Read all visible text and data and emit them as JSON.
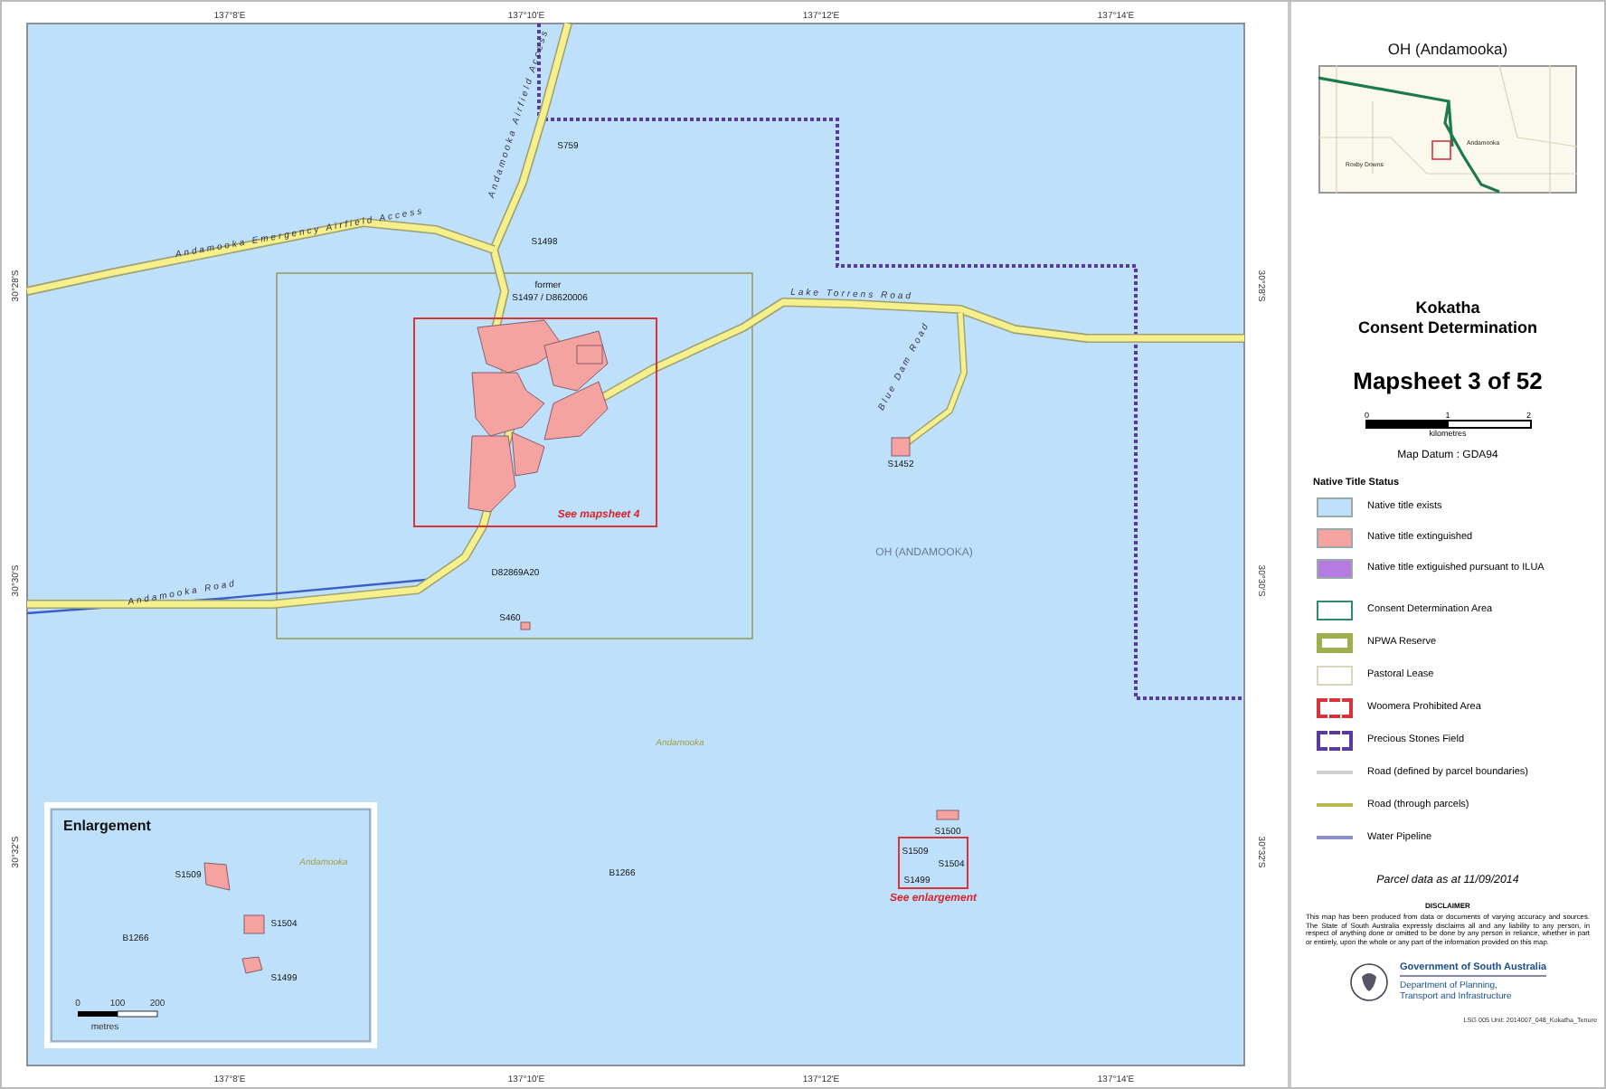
{
  "map": {
    "top_ticks": [
      "137°8'E",
      "137°10'E",
      "137°12'E",
      "137°14'E"
    ],
    "bottom_ticks": [
      "137°8'E",
      "137°10'E",
      "137°12'E",
      "137°14'E"
    ],
    "left_ticks": [
      "30°28'S",
      "30°30'S",
      "30°32'S"
    ],
    "right_ticks": [
      "30°28'S",
      "30°30'S",
      "30°32'S"
    ],
    "labels": [
      {
        "text": "Andamooka Emergency Airfield Access",
        "kind": "road"
      },
      {
        "text": "Andamooka Airfield Access",
        "kind": "road"
      },
      {
        "text": "S759",
        "kind": "parcel"
      },
      {
        "text": "S1498",
        "kind": "parcel"
      },
      {
        "text": "former",
        "kind": "parcel"
      },
      {
        "text": "S1497 / D8620006",
        "kind": "parcel"
      },
      {
        "text": "Lake Torrens Road",
        "kind": "road"
      },
      {
        "text": "Blue Dam Road",
        "kind": "road"
      },
      {
        "text": "S1452",
        "kind": "parcel"
      },
      {
        "text": "See mapsheet 4",
        "kind": "callout"
      },
      {
        "text": "OH (ANDAMOOKA)",
        "kind": "area"
      },
      {
        "text": "Andamooka Road",
        "kind": "road"
      },
      {
        "text": "D82869A20",
        "kind": "parcel"
      },
      {
        "text": "S460",
        "kind": "parcel"
      },
      {
        "text": "Andamooka",
        "kind": "locality"
      },
      {
        "text": "B1266",
        "kind": "parcel"
      },
      {
        "text": "S1500",
        "kind": "parcel"
      },
      {
        "text": "S1509",
        "kind": "parcel"
      },
      {
        "text": "S1504",
        "kind": "parcel"
      },
      {
        "text": "S1499",
        "kind": "parcel"
      },
      {
        "text": "See enlargement",
        "kind": "callout"
      }
    ],
    "enlargement": {
      "title": "Enlargement",
      "labels": [
        {
          "text": "Andamooka",
          "kind": "locality"
        },
        {
          "text": "S1509",
          "kind": "parcel"
        },
        {
          "text": "S1504",
          "kind": "parcel"
        },
        {
          "text": "B1266",
          "kind": "parcel"
        },
        {
          "text": "S1499",
          "kind": "parcel"
        }
      ],
      "scale_ticks": [
        "0",
        "100",
        "200"
      ],
      "scale_unit": "metres"
    }
  },
  "panel": {
    "location": "OH (Andamooka)",
    "inset_labels": [
      "Andamooka",
      "Roxby Downs"
    ],
    "title_lines": [
      "Kokatha",
      "Consent Determination"
    ],
    "mapsheet": "Mapsheet 3 of 52",
    "scale_ticks": [
      "0",
      "1",
      "2"
    ],
    "scale_unit": "kilometres",
    "datum": "Map Datum : GDA94",
    "legend_title": "Native Title Status",
    "status_items": [
      {
        "label": "Native title exists",
        "kind": "fill",
        "color": "#bfe0fb"
      },
      {
        "label": "Native title extinguished",
        "kind": "fill",
        "color": "#f4a3a0"
      },
      {
        "label": "Native title extiguished pursuant to ILUA",
        "kind": "fill",
        "color": "#b57be0"
      }
    ],
    "feature_items": [
      {
        "label": "Consent Determination Area",
        "kind": "outline",
        "color": "#2e8a6a"
      },
      {
        "label": "NPWA Reserve",
        "kind": "thick",
        "color": "#9cb04e"
      },
      {
        "label": "Pastoral Lease",
        "kind": "outline",
        "color": "#d9d6bf"
      },
      {
        "label": "Woomera Prohibited Area",
        "kind": "dashed",
        "color": "#d8333a"
      },
      {
        "label": "Precious Stones Field",
        "kind": "dashed",
        "color": "#5a3a9c"
      },
      {
        "label": "Road (defined by parcel boundaries)",
        "kind": "line",
        "color": "#cfcfcf"
      },
      {
        "label": "Road (through parcels)",
        "kind": "line",
        "color": "#b5b94e"
      },
      {
        "label": "Water Pipeline",
        "kind": "line",
        "color": "#8d8fc8"
      }
    ],
    "parcel_date": "Parcel data as at 11/09/2014",
    "disclaimer_title": "DISCLAIMER",
    "disclaimer": "This map has been produced from data or documents of varying accuracy and sources. The State of South Australia expressly disclaims all and any liability to any person, in respect of anything done or omitted to be done by any person in reliance, whether in part or entirely, upon the whole or any part of the information provided on this map.",
    "government": "Government of South Australia",
    "department": "Department of Planning, Transport and Infrastructure",
    "file_ref": "LSG 005 Unit: 2014007_048_Kokatha_Tenure"
  }
}
